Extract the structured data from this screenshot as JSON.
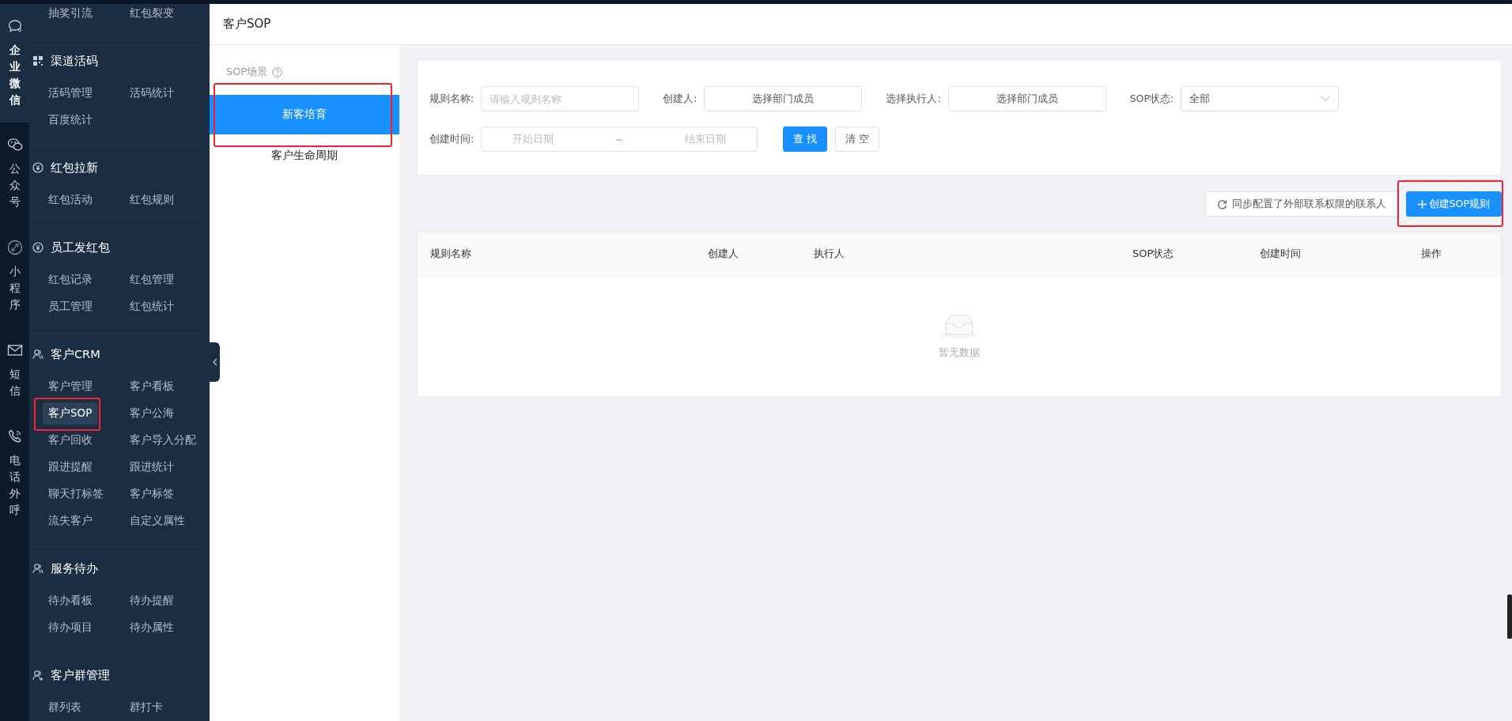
{
  "rail": [
    {
      "label": "企业微信",
      "selected": true
    },
    {
      "label": "公众号",
      "selected": false
    },
    {
      "label": "小程序",
      "selected": false
    },
    {
      "label": "短信",
      "selected": false
    },
    {
      "label": "电话外呼",
      "selected": false
    }
  ],
  "menu": {
    "top_items": [
      {
        "label": "抽奖引流",
        "selected": false,
        "highlighted": false
      },
      {
        "label": "红包裂变",
        "selected": false,
        "highlighted": false
      }
    ],
    "sections": [
      {
        "title": "渠道活码",
        "items": [
          {
            "label": "活码管理",
            "selected": false,
            "highlighted": false
          },
          {
            "label": "活码统计",
            "selected": false,
            "highlighted": false
          },
          {
            "label": "百度统计",
            "selected": false,
            "highlighted": false
          }
        ]
      },
      {
        "title": "红包拉新",
        "items": [
          {
            "label": "红包活动",
            "selected": false,
            "highlighted": false
          },
          {
            "label": "红包规则",
            "selected": false,
            "highlighted": false
          }
        ]
      },
      {
        "title": "员工发红包",
        "items": [
          {
            "label": "红包记录",
            "selected": false,
            "highlighted": false
          },
          {
            "label": "红包管理",
            "selected": false,
            "highlighted": false
          },
          {
            "label": "员工管理",
            "selected": false,
            "highlighted": false
          },
          {
            "label": "红包统计",
            "selected": false,
            "highlighted": false
          }
        ]
      },
      {
        "title": "客户CRM",
        "items": [
          {
            "label": "客户管理",
            "selected": false,
            "highlighted": false
          },
          {
            "label": "客户看板",
            "selected": false,
            "highlighted": false
          },
          {
            "label": "客户SOP",
            "selected": true,
            "highlighted": true
          },
          {
            "label": "客户公海",
            "selected": false,
            "highlighted": false
          },
          {
            "label": "客户回收",
            "selected": false,
            "highlighted": false
          },
          {
            "label": "客户导入分配",
            "selected": false,
            "highlighted": false
          },
          {
            "label": "跟进提醒",
            "selected": false,
            "highlighted": false
          },
          {
            "label": "跟进统计",
            "selected": false,
            "highlighted": false
          },
          {
            "label": "聊天打标签",
            "selected": false,
            "highlighted": false
          },
          {
            "label": "客户标签",
            "selected": false,
            "highlighted": false
          },
          {
            "label": "流失客户",
            "selected": false,
            "highlighted": false
          },
          {
            "label": "自定义属性",
            "selected": false,
            "highlighted": false
          }
        ]
      },
      {
        "title": "服务待办",
        "items": [
          {
            "label": "待办看板",
            "selected": false,
            "highlighted": false
          },
          {
            "label": "待办提醒",
            "selected": false,
            "highlighted": false
          },
          {
            "label": "待办项目",
            "selected": false,
            "highlighted": false
          },
          {
            "label": "待办属性",
            "selected": false,
            "highlighted": false
          }
        ]
      },
      {
        "title": "客户群管理",
        "items": [
          {
            "label": "群列表",
            "selected": false,
            "highlighted": false
          },
          {
            "label": "群打卡",
            "selected": false,
            "highlighted": false
          }
        ]
      }
    ]
  },
  "page_title": "客户SOP",
  "scenes": {
    "title": "SOP场景",
    "items": [
      {
        "label": "新客培育",
        "selected": true,
        "highlighted": true
      },
      {
        "label": "客户生命周期",
        "selected": false,
        "highlighted": false
      }
    ]
  },
  "filters": [
    {
      "kind": "text",
      "label": "规则名称:",
      "placeholder": "请输入规则名称"
    },
    {
      "kind": "picker",
      "label": "创建人:",
      "placeholder": "选择部门成员"
    },
    {
      "kind": "picker",
      "label": "选择执行人:",
      "placeholder": "选择部门成员"
    },
    {
      "kind": "select",
      "label": "SOP状态:",
      "value": "全部"
    },
    {
      "kind": "daterange",
      "label": "创建时间:",
      "start_placeholder": "开始日期",
      "separator": "~",
      "end_placeholder": "结束日期"
    }
  ],
  "filter_buttons": [
    {
      "kind": "primary",
      "label": "查 找"
    },
    {
      "kind": "default",
      "label": "清 空"
    }
  ],
  "actions": [
    {
      "kind": "sync",
      "label": "同步配置了外部联系权限的联系人",
      "highlighted": false
    },
    {
      "kind": "create",
      "label": "创建SOP规则",
      "highlighted": true
    }
  ],
  "table": {
    "columns": [
      "规则名称",
      "创建人",
      "执行人",
      "SOP状态",
      "创建时间",
      "操作"
    ],
    "empty_text": "暂无数据"
  }
}
